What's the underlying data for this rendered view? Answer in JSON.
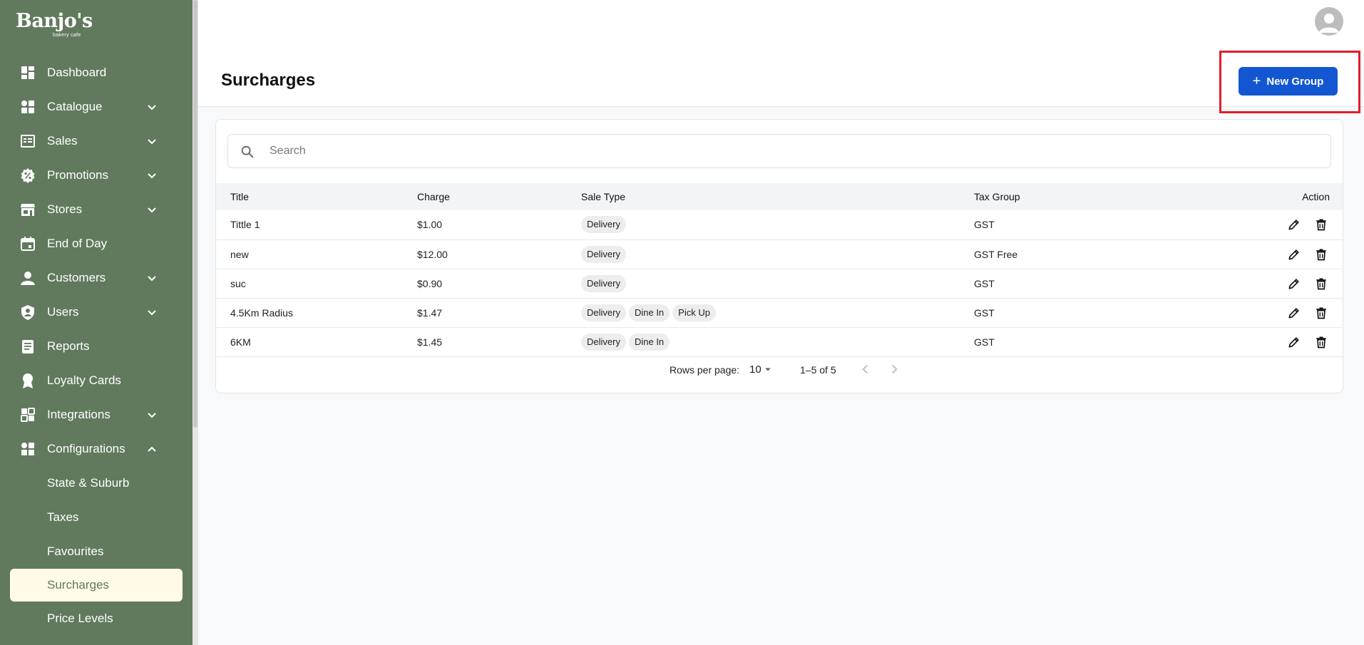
{
  "brand": {
    "name": "Banjo's",
    "tagline": "bakery cafe"
  },
  "sidebar": {
    "items": [
      {
        "label": "Dashboard",
        "icon": "dashboard-icon",
        "expandable": false
      },
      {
        "label": "Catalogue",
        "icon": "catalogue-icon",
        "expandable": true
      },
      {
        "label": "Sales",
        "icon": "sales-icon",
        "expandable": true
      },
      {
        "label": "Promotions",
        "icon": "promotions-icon",
        "expandable": true
      },
      {
        "label": "Stores",
        "icon": "store-icon",
        "expandable": true
      },
      {
        "label": "End of Day",
        "icon": "calendar-icon",
        "expandable": false
      },
      {
        "label": "Customers",
        "icon": "person-icon",
        "expandable": true
      },
      {
        "label": "Users",
        "icon": "shield-user-icon",
        "expandable": true
      },
      {
        "label": "Reports",
        "icon": "reports-icon",
        "expandable": false
      },
      {
        "label": "Loyalty Cards",
        "icon": "award-icon",
        "expandable": false
      },
      {
        "label": "Integrations",
        "icon": "integrations-icon",
        "expandable": true
      },
      {
        "label": "Configurations",
        "icon": "configurations-icon",
        "expandable": true,
        "expanded": true
      }
    ],
    "subitems": [
      {
        "label": "State & Suburb"
      },
      {
        "label": "Taxes"
      },
      {
        "label": "Favourites"
      },
      {
        "label": "Surcharges",
        "active": true
      },
      {
        "label": "Price Levels"
      }
    ]
  },
  "header": {
    "title": "Surcharges",
    "new_button_label": "New Group"
  },
  "search": {
    "placeholder": "Search",
    "value": ""
  },
  "table": {
    "columns": [
      "Title",
      "Charge",
      "Sale Type",
      "Tax Group",
      "Action"
    ],
    "rows": [
      {
        "title": "Tittle 1",
        "charge": "$1.00",
        "sale_types": [
          "Delivery"
        ],
        "tax_group": "GST"
      },
      {
        "title": "new",
        "charge": "$12.00",
        "sale_types": [
          "Delivery"
        ],
        "tax_group": "GST Free"
      },
      {
        "title": "suc",
        "charge": "$0.90",
        "sale_types": [
          "Delivery"
        ],
        "tax_group": "GST"
      },
      {
        "title": "4.5Km Radius",
        "charge": "$1.47",
        "sale_types": [
          "Delivery",
          "Dine In",
          "Pick Up"
        ],
        "tax_group": "GST"
      },
      {
        "title": "6KM",
        "charge": "$1.45",
        "sale_types": [
          "Delivery",
          "Dine In"
        ],
        "tax_group": "GST"
      }
    ]
  },
  "pagination": {
    "rows_per_page_label": "Rows per page:",
    "rows_per_page": "10",
    "range": "1–5 of 5"
  },
  "colors": {
    "sidebar_bg": "#617a5e",
    "active_item_bg": "#fffbe8",
    "primary_button": "#1257d1",
    "highlight_box": "#e11d2a"
  }
}
